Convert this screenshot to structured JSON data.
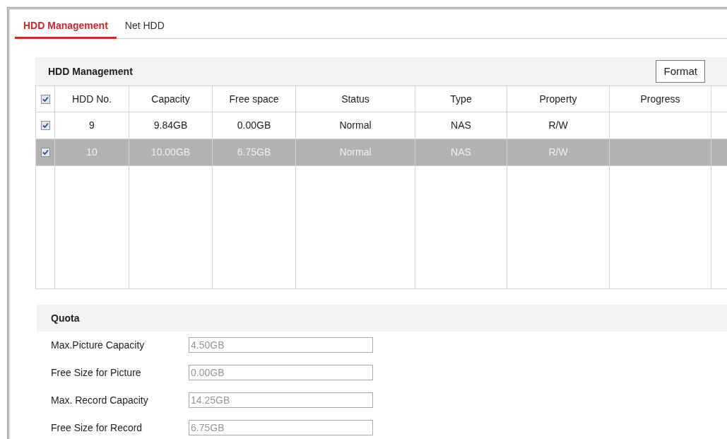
{
  "tabs": [
    {
      "label": "HDD Management",
      "selected": true
    },
    {
      "label": "Net HDD",
      "selected": false
    }
  ],
  "hdd_panel": {
    "title": "HDD Management",
    "format_button": "Format",
    "table": {
      "all_checked": true,
      "columns": [
        "HDD No.",
        "Capacity",
        "Free space",
        "Status",
        "Type",
        "Property",
        "Progress"
      ],
      "rows": [
        {
          "checked": true,
          "selected": false,
          "cells": [
            "9",
            "9.84GB",
            "0.00GB",
            "Normal",
            "NAS",
            "R/W",
            ""
          ]
        },
        {
          "checked": true,
          "selected": true,
          "cells": [
            "10",
            "10.00GB",
            "6.75GB",
            "Normal",
            "NAS",
            "R/W",
            ""
          ]
        }
      ]
    }
  },
  "quota": {
    "title": "Quota",
    "fields": [
      {
        "label": "Max.Picture Capacity",
        "value": "4.50GB",
        "disabled": true
      },
      {
        "label": "Free Size for Picture",
        "value": "0.00GB",
        "disabled": true
      },
      {
        "label": "Max. Record Capacity",
        "value": "14.25GB",
        "disabled": true
      },
      {
        "label": "Free Size for Record",
        "value": "6.75GB",
        "disabled": true
      }
    ]
  }
}
